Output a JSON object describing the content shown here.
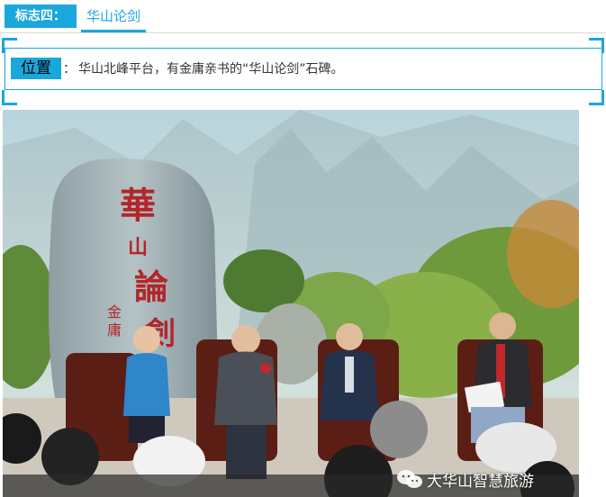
{
  "header": {
    "tag_label": "标志四：",
    "title": "华山论剑"
  },
  "location": {
    "tag_label": "位置",
    "colon": "：",
    "text": "华山北峰平台，有金庸亲书的“华山论剑”石碑。"
  },
  "photo": {
    "stone_inscription": "華山論劍",
    "signature": "金庸"
  },
  "watermark": {
    "icon": "wechat-icon",
    "text": "大华山智慧旅游"
  },
  "colors": {
    "accent": "#1aa7dc",
    "text": "#333333"
  }
}
